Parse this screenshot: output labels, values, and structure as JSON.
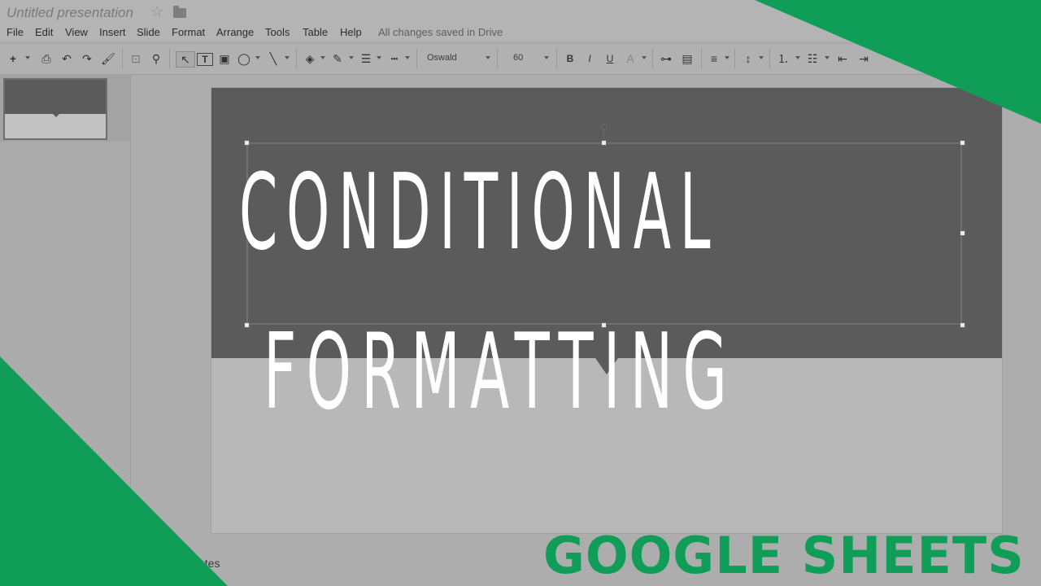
{
  "document": {
    "title": "Untitled presentation"
  },
  "menu": {
    "items": [
      "File",
      "Edit",
      "View",
      "Insert",
      "Slide",
      "Format",
      "Arrange",
      "Tools",
      "Table",
      "Help"
    ],
    "save_status": "All changes saved in Drive"
  },
  "toolbar": {
    "font_family": "Oswald",
    "font_size": "60",
    "bold": "B",
    "italic": "I",
    "underline": "U"
  },
  "slide": {
    "line1": "CONDITIONAL",
    "line2": "FORMATTING"
  },
  "speaker_notes": {
    "label": "otes"
  },
  "overlay": {
    "brand_text": "GOOGLE SHEETS",
    "accent_color": "#0f9d58"
  },
  "colors": {
    "header_band": "#5b5b5b",
    "slide_body": "#b8b8b8",
    "app_bg": "#adadad"
  }
}
